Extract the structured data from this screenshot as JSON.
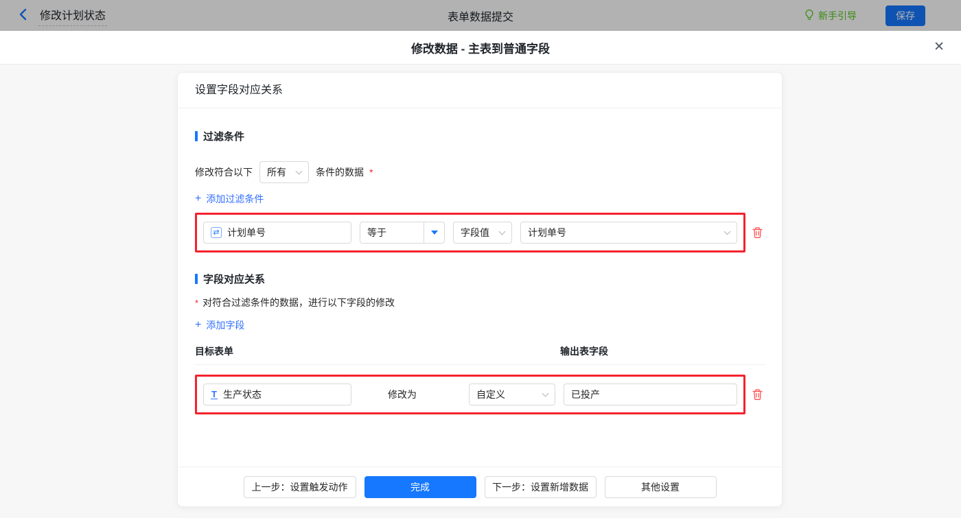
{
  "topbar": {
    "title": "修改计划状态",
    "center_title": "表单数据提交",
    "guide_label": "新手引导",
    "save_label": "保存"
  },
  "dialog": {
    "title": "修改数据 - 主表到普通字段",
    "close_glyph": "✕"
  },
  "panel": {
    "header": "设置字段对应关系",
    "filter_section": {
      "title": "过滤条件",
      "match_prefix": "修改符合以下",
      "match_select_value": "所有",
      "match_suffix": "条件的数据",
      "required_mark": "*",
      "add_link_label": "添加过滤条件",
      "rows": [
        {
          "field": "计划单号",
          "operator": "等于",
          "value_type": "字段值",
          "value": "计划单号"
        }
      ]
    },
    "mapping_section": {
      "title": "字段对应关系",
      "required_mark": "*",
      "description": "对符合过滤条件的数据，进行以下字段的修改",
      "add_link_label": "添加字段",
      "col_target": "目标表单",
      "col_output": "输出表字段",
      "rows": [
        {
          "field": "生产状态",
          "action_label": "修改为",
          "value_type": "自定义",
          "value": "已投产"
        }
      ]
    }
  },
  "footer": {
    "prev_label": "上一步：设置触发动作",
    "done_label": "完成",
    "next_label": "下一步：设置新增数据",
    "other_label": "其他设置"
  },
  "icons": {
    "plus": "+",
    "serial_field": "⇄",
    "text_field": "T"
  },
  "colors": {
    "primary_blue": "#1677ff",
    "link_blue": "#3370ff",
    "highlight_red": "#f5222d",
    "danger_red": "#ff4d4f",
    "guide_green": "#52c41a"
  }
}
